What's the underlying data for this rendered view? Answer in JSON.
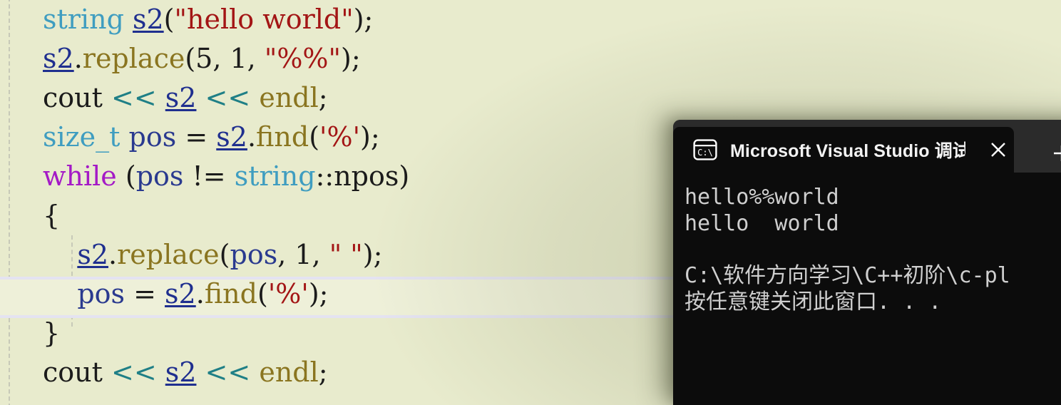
{
  "editor": {
    "name": "visual-studio-code-editor",
    "background_color": "#e8ebcd",
    "current_line_highlight": "#eef0d9",
    "current_line_border": "#e4e3f1",
    "indent_guide_color": "#c7c9b8",
    "lines": [
      {
        "id": "line-string-s2-declaration",
        "tokens": [
          {
            "text": "string",
            "kind": "type"
          },
          {
            "text": " ",
            "kind": "plain"
          },
          {
            "text": "s2",
            "kind": "var"
          },
          {
            "text": "(",
            "kind": "plain"
          },
          {
            "text": "\"hello world\"",
            "kind": "str"
          },
          {
            "text": ");",
            "kind": "plain"
          }
        ]
      },
      {
        "id": "line-s2-replace-5-1",
        "tokens": [
          {
            "text": "s2",
            "kind": "var"
          },
          {
            "text": ".",
            "kind": "plain"
          },
          {
            "text": "replace",
            "kind": "fn"
          },
          {
            "text": "(5, 1, ",
            "kind": "plain"
          },
          {
            "text": "\"%%\"",
            "kind": "str"
          },
          {
            "text": ");",
            "kind": "plain"
          }
        ]
      },
      {
        "id": "line-cout-s2-endl-first",
        "tokens": [
          {
            "text": "cout ",
            "kind": "plain"
          },
          {
            "text": "<<",
            "kind": "op"
          },
          {
            "text": " ",
            "kind": "plain"
          },
          {
            "text": "s2",
            "kind": "var"
          },
          {
            "text": " ",
            "kind": "plain"
          },
          {
            "text": "<<",
            "kind": "op"
          },
          {
            "text": " ",
            "kind": "plain"
          },
          {
            "text": "endl",
            "kind": "fn"
          },
          {
            "text": ";",
            "kind": "plain"
          }
        ]
      },
      {
        "id": "line-size-t-pos-find",
        "tokens": [
          {
            "text": "size_t",
            "kind": "type"
          },
          {
            "text": " ",
            "kind": "plain"
          },
          {
            "text": "pos",
            "kind": "varp"
          },
          {
            "text": " = ",
            "kind": "plain"
          },
          {
            "text": "s2",
            "kind": "var"
          },
          {
            "text": ".",
            "kind": "plain"
          },
          {
            "text": "find",
            "kind": "fn"
          },
          {
            "text": "(",
            "kind": "plain"
          },
          {
            "text": "'%'",
            "kind": "str"
          },
          {
            "text": ");",
            "kind": "plain"
          }
        ]
      },
      {
        "id": "line-while-pos-npos",
        "tokens": [
          {
            "text": "while",
            "kind": "kw"
          },
          {
            "text": " (",
            "kind": "plain"
          },
          {
            "text": "pos",
            "kind": "varp"
          },
          {
            "text": " != ",
            "kind": "plain"
          },
          {
            "text": "string",
            "kind": "type"
          },
          {
            "text": "::npos)",
            "kind": "plain"
          }
        ]
      },
      {
        "id": "line-open-brace",
        "tokens": [
          {
            "text": "{",
            "kind": "plain"
          }
        ]
      },
      {
        "id": "line-s2-replace-pos-1-space",
        "tokens": [
          {
            "text": "    ",
            "kind": "plain"
          },
          {
            "text": "s2",
            "kind": "var"
          },
          {
            "text": ".",
            "kind": "plain"
          },
          {
            "text": "replace",
            "kind": "fn"
          },
          {
            "text": "(",
            "kind": "plain"
          },
          {
            "text": "pos",
            "kind": "varp"
          },
          {
            "text": ", 1, ",
            "kind": "plain"
          },
          {
            "text": "\" \"",
            "kind": "str"
          },
          {
            "text": ");",
            "kind": "plain"
          }
        ]
      },
      {
        "id": "line-pos-equals-find",
        "current": true,
        "tokens": [
          {
            "text": "    ",
            "kind": "plain"
          },
          {
            "text": "pos",
            "kind": "varp"
          },
          {
            "text": " = ",
            "kind": "plain"
          },
          {
            "text": "s2",
            "kind": "var"
          },
          {
            "text": ".",
            "kind": "plain"
          },
          {
            "text": "find",
            "kind": "fn"
          },
          {
            "text": "(",
            "kind": "plain"
          },
          {
            "text": "'%'",
            "kind": "str"
          },
          {
            "text": ");",
            "kind": "plain"
          }
        ]
      },
      {
        "id": "line-close-brace",
        "tokens": [
          {
            "text": "}",
            "kind": "plain"
          }
        ]
      },
      {
        "id": "line-cout-s2-endl-second",
        "tokens": [
          {
            "text": "cout ",
            "kind": "plain"
          },
          {
            "text": "<<",
            "kind": "op"
          },
          {
            "text": " ",
            "kind": "plain"
          },
          {
            "text": "s2",
            "kind": "var"
          },
          {
            "text": " ",
            "kind": "plain"
          },
          {
            "text": "<<",
            "kind": "op"
          },
          {
            "text": " ",
            "kind": "plain"
          },
          {
            "text": "endl",
            "kind": "fn"
          },
          {
            "text": ";",
            "kind": "plain"
          }
        ]
      }
    ]
  },
  "console_window": {
    "tab": {
      "icon": "console-cmd-icon",
      "icon_label": "C:\\",
      "title": "Microsoft Visual Studio 调试控",
      "close_label": "✕"
    },
    "new_tab_label": "+",
    "background_color": "#0c0c0c",
    "tabbar_color": "#2b2b2b",
    "text_color": "#cfcfcf",
    "output_lines": [
      "hello%%world",
      "hello  world",
      "",
      "C:\\软件方向学习\\C++初阶\\c-pl",
      "按任意键关闭此窗口. . ."
    ]
  }
}
